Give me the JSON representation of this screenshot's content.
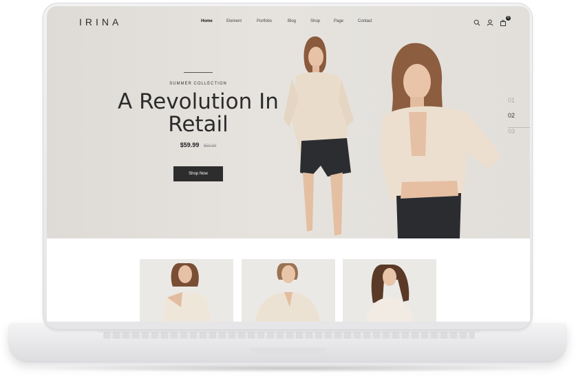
{
  "brand": "IRINA",
  "nav": {
    "items": [
      "Home",
      "Element",
      "Portfolio",
      "Blog",
      "Shop",
      "Page",
      "Contact"
    ],
    "active": "Home"
  },
  "header_icons": [
    "search-icon",
    "user-icon",
    "cart-icon"
  ],
  "cart_count": "0",
  "hero": {
    "kicker": "SUMMER COLLECTION",
    "title_line1": "A Revolution In",
    "title_line2": "Retail",
    "price": "$59.99",
    "old_price": "$59.99",
    "button": "Shop Now"
  },
  "slides": [
    "01",
    "02",
    "03"
  ],
  "active_slide": "02",
  "colors": {
    "hero_bg": "#e2dfdb",
    "button_bg": "#2d2d2d",
    "text_dark": "#2b2b2b"
  }
}
